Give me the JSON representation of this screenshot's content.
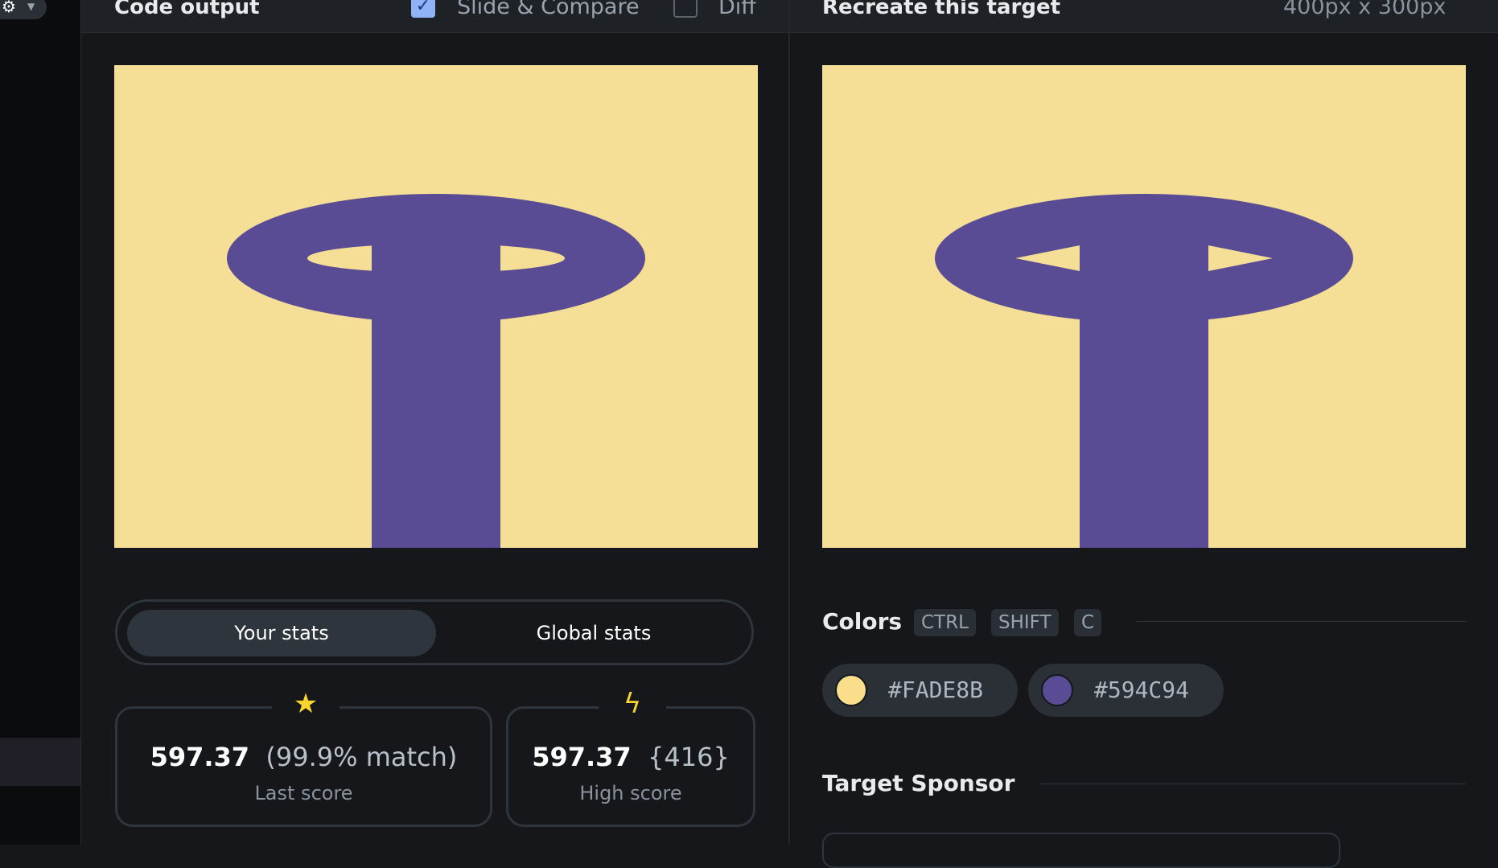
{
  "left_panel": {
    "title": "Code output",
    "slide_compare_label": "Slide & Compare",
    "slide_compare_checked": true,
    "diff_label": "Diff",
    "diff_checked": false
  },
  "right_panel": {
    "title": "Recreate this target",
    "size_label": "400px x 300px"
  },
  "canvas": {
    "background": "#F5DE95",
    "shape_color": "#594C94"
  },
  "tabs": {
    "your_stats": "Your stats",
    "global_stats": "Global stats",
    "active": "your_stats"
  },
  "stats": {
    "last_score": {
      "value": "597.37",
      "detail": "(99.9% match)",
      "label": "Last score",
      "icon": "star-icon"
    },
    "high_score": {
      "value": "597.37",
      "detail": "{416}",
      "label": "High score",
      "icon": "bolt-icon"
    }
  },
  "colors_section": {
    "title": "Colors",
    "shortcut": [
      "CTRL",
      "SHIFT",
      "C"
    ],
    "swatches": [
      {
        "hex": "#FADE8B",
        "color": "#FADE8B"
      },
      {
        "hex": "#594C94",
        "color": "#594C94"
      }
    ]
  },
  "sponsor_section": {
    "title": "Target Sponsor"
  },
  "icons": {
    "settings": "gear-icon",
    "dropdown": "caret-down-icon",
    "check": "check-icon"
  }
}
